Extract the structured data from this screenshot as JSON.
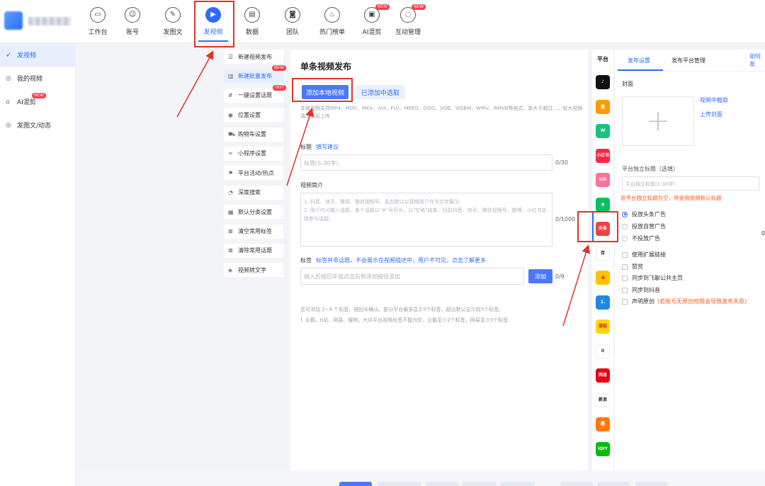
{
  "topnav": {
    "items": [
      {
        "label": "工作台",
        "icon": "monitor-icon",
        "glyph": "▭"
      },
      {
        "label": "账号",
        "icon": "user-icon",
        "glyph": "☺"
      },
      {
        "label": "发图文",
        "icon": "feather-icon",
        "glyph": "✎"
      },
      {
        "label": "发视频",
        "icon": "play-icon",
        "glyph": "▶",
        "active": true
      },
      {
        "label": "数据",
        "icon": "chart-icon",
        "glyph": "▤"
      },
      {
        "label": "团队",
        "icon": "team-icon",
        "glyph": "◙"
      },
      {
        "label": "热门榜单",
        "icon": "flame-icon",
        "glyph": "♨"
      },
      {
        "label": "AI混剪",
        "icon": "briefcase-icon",
        "glyph": "▣",
        "badge": "NEW"
      },
      {
        "label": "互动管理",
        "icon": "chat-icon",
        "glyph": "◌",
        "badge": "NEW"
      }
    ]
  },
  "sidebar": {
    "items": [
      {
        "label": "发视频",
        "icon": "send-icon",
        "glyph": "➶",
        "active": true
      },
      {
        "label": "我的视频",
        "icon": "video-circle-icon",
        "glyph": "◎"
      },
      {
        "label": "AI混剪",
        "icon": "ai-icon",
        "glyph": "⌂",
        "badge": "NEW"
      },
      {
        "label": "发图文/动态",
        "icon": "post-icon",
        "glyph": "◎"
      }
    ]
  },
  "settings_menu": {
    "items": [
      {
        "label": "新建视频发布",
        "icon": "list-icon",
        "glyph": "☰"
      },
      {
        "label": "新建批量发布",
        "icon": "batch-icon",
        "glyph": "▥",
        "active": true,
        "tag": "NEW"
      },
      {
        "label": "一键设置话题",
        "icon": "hash-icon",
        "glyph": "#",
        "tag": "HOT"
      },
      {
        "label": "位置设置",
        "icon": "location-icon",
        "glyph": "◉"
      },
      {
        "label": "购物车设置",
        "icon": "cart-icon",
        "glyph": "⛟"
      },
      {
        "label": "小程序设置",
        "icon": "link-icon",
        "glyph": "∞"
      },
      {
        "label": "平台活动/热点",
        "icon": "flag-icon",
        "glyph": "⚑"
      },
      {
        "label": "深度搜索",
        "icon": "search-icon",
        "glyph": "◔"
      },
      {
        "label": "默认分类设置",
        "icon": "grid-icon",
        "glyph": "▦"
      },
      {
        "label": "清空常用标签",
        "icon": "clear-tag-icon",
        "glyph": "⊠"
      },
      {
        "label": "清除常用话题",
        "icon": "clear-topic-icon",
        "glyph": "⊠"
      },
      {
        "label": "视频转文字",
        "icon": "convert-icon",
        "glyph": "◈"
      }
    ]
  },
  "main": {
    "title": "单条视频发布",
    "add_local_button": "添加本地视频",
    "add_existing_button": "已添加中选取",
    "format_hint": "本地视频支持MP4、MOV、MKV、AVI、FLV、MPEG、OGG、VOB、WEBM、WMV、RMVB等格式，单大不超过…，较大视频请压缩后上传",
    "title_label": "标题",
    "title_link": "填写建议",
    "title_placeholder": "标题(5-30字)",
    "title_counter": "0/30",
    "desc_label": "视频简介",
    "desc_placeholder": "1. 抖音、快手、微视、微信视频号、反应默认以视频简介作为文字展示;\n2. 简介内可输入话题，单个话题以\"#\"号开头，以\"空格\"结束，目前抖音、快手、微信视频号、微博、小红书支持参与话题;",
    "desc_counter": "0/1000",
    "tag_label": "标签",
    "tag_note": "标签并非话题，不会展示在视频描述中，用户不可见，点击了解更多",
    "tag_placeholder": "输入后按回车或点击右侧添加按钮添加",
    "tag_add_button": "添加",
    "tag_counter": "0/9",
    "tips_line1": "您可添加 2~9 个标签，按回车确认。部分平台最多显示5个标签，超出默认显示前5个标签。",
    "tips_line2": "企鹅、b站、网易、搜狗、大风平台视频标签不能为空，企鹅至少2个标签，网易至少3个标签"
  },
  "platforms": {
    "title": "平台",
    "items": [
      {
        "name": "抖音",
        "icon": "douyin-icon",
        "color": "#111111",
        "glyph": "♪"
      },
      {
        "name": "快手",
        "icon": "kuaishou-icon",
        "color": "#ff9a00",
        "glyph": "◙"
      },
      {
        "name": "微视",
        "icon": "weishi-icon",
        "color": "#19c37d",
        "glyph": "W"
      },
      {
        "name": "小红书",
        "icon": "xiaohongshu-icon",
        "color": "#ff2442",
        "glyph": "小红书"
      },
      {
        "name": "哔哩哔哩",
        "icon": "bilibili-icon",
        "color": "#fb7299",
        "glyph": "bili"
      },
      {
        "name": "微信视频号",
        "icon": "wechat-icon",
        "color": "#07c160",
        "glyph": "◉"
      },
      {
        "name": "头条",
        "icon": "toutiao-icon",
        "color": "#f04142",
        "glyph": "头条"
      },
      {
        "name": "百家号",
        "icon": "baijiahao-icon",
        "color": "#ffffff",
        "glyph": "百"
      },
      {
        "name": "企鹅号",
        "icon": "qq-icon",
        "color": "#ffc300",
        "glyph": "◕"
      },
      {
        "name": "一点号",
        "icon": "yidian-icon",
        "color": "#1e88e5",
        "glyph": "1."
      },
      {
        "name": "搜狐",
        "icon": "sohu-icon",
        "color": "#ffd400",
        "glyph": "搜狐"
      },
      {
        "name": "大风号",
        "icon": "dafeng-icon",
        "color": "#ffffff",
        "glyph": "ᘐ"
      },
      {
        "name": "网易",
        "icon": "netease-icon",
        "color": "#e60012",
        "glyph": "网易"
      },
      {
        "name": "新浪",
        "icon": "xinlang-icon",
        "color": "#ffffff",
        "glyph": "新浪"
      },
      {
        "name": "趣头条",
        "icon": "qutoutiao-icon",
        "color": "#ff7a00",
        "glyph": "趣"
      },
      {
        "name": "爱奇艺",
        "icon": "iqiyi-icon",
        "color": "#00be06",
        "glyph": "iQIY"
      }
    ]
  },
  "right_panel": {
    "tab_active": "发布设置",
    "tab2": "发布平台管理",
    "tab3_cut": "如何发",
    "cover_label": "封面",
    "cover_plus": "+",
    "link_capture": "视频中截取",
    "link_upload": "上传封面",
    "indep_title_label": "平台独立标题（选填）",
    "indep_title_placeholder": "平台独立标题(1-30字)",
    "indep_title_warn": "若平台独立标题为空，将使用视频默认标题",
    "ad_options": [
      "投放头条广告",
      "投放自营广告",
      "不投放广告"
    ],
    "check_options": [
      "使用扩展链接",
      "赞赏",
      "同步到飞聊公共主页",
      "同步到抖音",
      "声明原创"
    ],
    "original_warn": "(若账号无原创权限会导致发布失败)",
    "cut_edge": "0"
  }
}
